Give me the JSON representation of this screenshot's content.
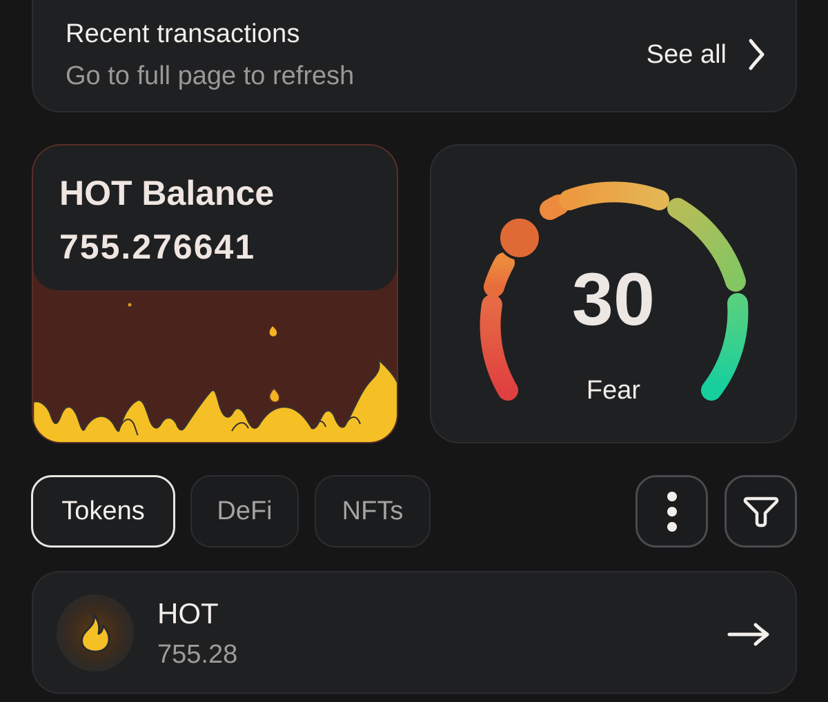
{
  "recent_transactions": {
    "title": "Recent transactions",
    "subtitle": "Go to full page to refresh",
    "see_all_label": "See all",
    "icon": "chevron-right-icon"
  },
  "hot_balance": {
    "title": "HOT Balance",
    "value": "755.276641",
    "decoration": "flames-illustration"
  },
  "fear_greed": {
    "value": "30",
    "label": "Fear",
    "level": 0.3,
    "colors": {
      "low": "#e0403c",
      "mid_low": "#ea7a3a",
      "mid": "#e9b14a",
      "mid_high": "#9bc15c",
      "high": "#1ecf9a",
      "indicator": "#e06a35"
    }
  },
  "tabs": [
    {
      "label": "Tokens",
      "active": true
    },
    {
      "label": "DeFi",
      "active": false
    },
    {
      "label": "NFTs",
      "active": false
    }
  ],
  "toolbar": {
    "more_icon": "vertical-dots-icon",
    "filter_icon": "filter-icon"
  },
  "tokens": [
    {
      "symbol": "HOT",
      "amount": "755.28",
      "icon": "flame-icon"
    }
  ],
  "colors": {
    "background": "#161616",
    "card": "#1f2022",
    "flame": "#f5c026",
    "balance_bg": "#4a231d"
  }
}
